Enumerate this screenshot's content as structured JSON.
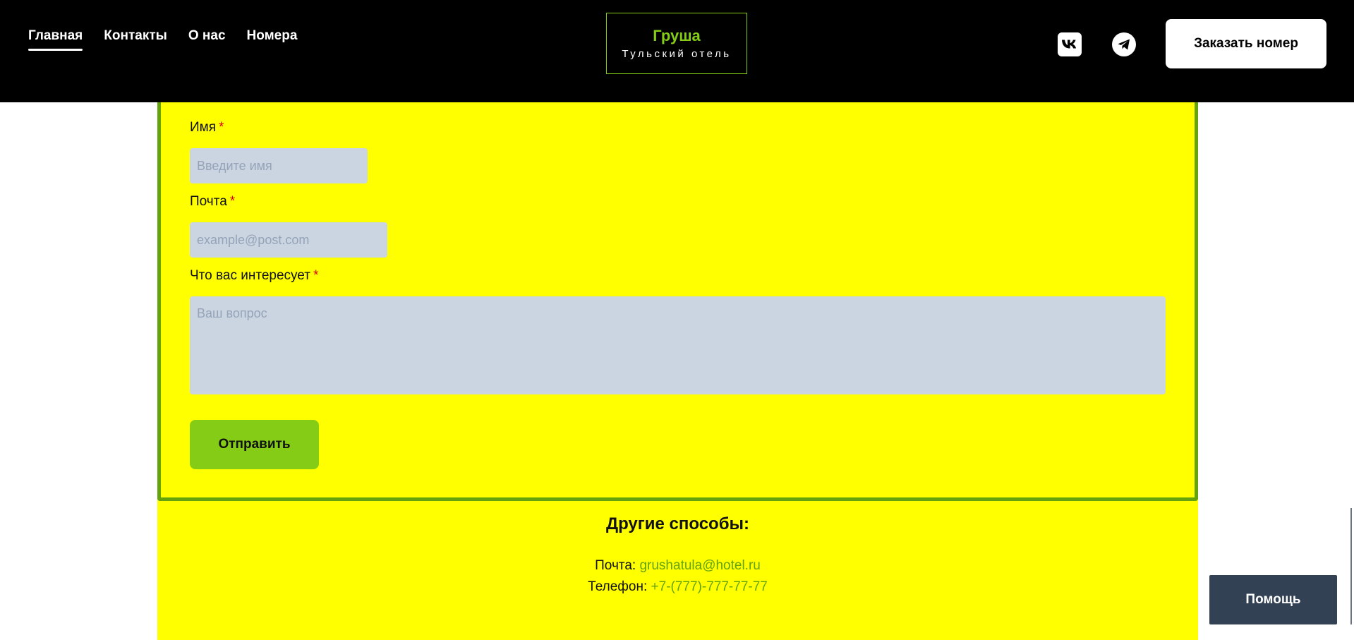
{
  "nav": {
    "items": [
      {
        "label": "Главная",
        "active": true
      },
      {
        "label": "Контакты",
        "active": false
      },
      {
        "label": "О нас",
        "active": false
      },
      {
        "label": "Номера",
        "active": false
      }
    ]
  },
  "logo": {
    "title": "Груша",
    "subtitle": "Тульский отель"
  },
  "header": {
    "social": [
      {
        "icon": "vk-icon"
      },
      {
        "icon": "telegram-icon"
      }
    ],
    "order_button": "Заказать номер"
  },
  "form": {
    "name": {
      "label": "Имя",
      "required_mark": "*",
      "placeholder": "Введите имя",
      "value": ""
    },
    "email": {
      "label": "Почта",
      "required_mark": "*",
      "placeholder": "example@post.com",
      "value": ""
    },
    "question": {
      "label": "Что вас интересует",
      "required_mark": "*",
      "placeholder": "Ваш вопрос",
      "value": ""
    },
    "submit": "Отправить"
  },
  "other_ways": {
    "title": "Другие способы:",
    "email_label": "Почта:",
    "email_value": "grushatula@hotel.ru",
    "phone_label": "Телефон:",
    "phone_value": "+7-(777)-777-77-77"
  },
  "help_button": "Помощь",
  "colors": {
    "header_bg": "#000000",
    "accent_green": "#84cc16",
    "frame_green": "#65a30d",
    "content_bg": "#ffff00",
    "input_bg": "#cbd5e1",
    "help_bg": "#334155",
    "required": "#dc0000"
  }
}
